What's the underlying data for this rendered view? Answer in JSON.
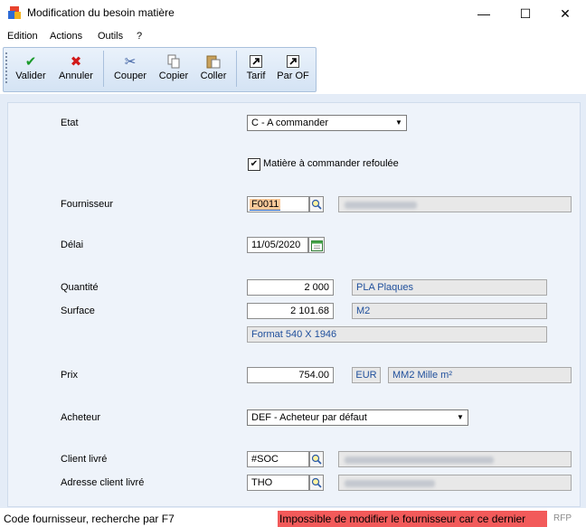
{
  "window": {
    "title": "Modification du besoin matière",
    "minimize": "—",
    "maximize": "☐",
    "close": "✕"
  },
  "menu": [
    "Edition",
    "Actions",
    "Outils",
    "?"
  ],
  "toolbar": {
    "valider": "Valider",
    "annuler": "Annuler",
    "couper": "Couper",
    "copier": "Copier",
    "coller": "Coller",
    "tarif": "Tarif",
    "par_of": "Par OF"
  },
  "form": {
    "etat": {
      "label": "Etat",
      "value": "C - A commander"
    },
    "refoulee": {
      "label": "Matière à commander refoulée",
      "checked": true
    },
    "fournisseur": {
      "label": "Fournisseur",
      "code": "F0011"
    },
    "delai": {
      "label": "Délai",
      "value": "11/05/2020"
    },
    "quantite": {
      "label": "Quantité",
      "value": "2 000",
      "unit": "PLA Plaques"
    },
    "surface": {
      "label": "Surface",
      "value": "2 101.68",
      "unit": "M2"
    },
    "format": "Format 540 X 1946",
    "prix": {
      "label": "Prix",
      "value": "754.00",
      "currency": "EUR",
      "unit": "MM2 Mille m²"
    },
    "acheteur": {
      "label": "Acheteur",
      "value": "DEF - Acheteur par défaut"
    },
    "client_livre": {
      "label": "Client livré",
      "value": "#SOC"
    },
    "adresse_client": {
      "label": "Adresse client livré",
      "value": "THO"
    }
  },
  "status": {
    "hint": "Code fournisseur, recherche par F7",
    "error": "Impossible de modifier le fournisseur car ce dernier",
    "mode": "RFP",
    "error_color": "#f25a5a"
  }
}
